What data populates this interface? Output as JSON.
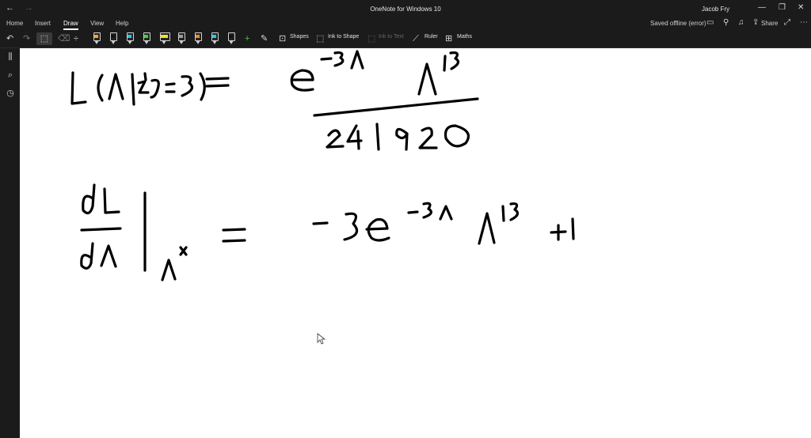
{
  "titlebar": {
    "back_icon": "back-arrow-icon",
    "forward_icon": "forward-arrow-icon",
    "app_title": "OneNote for Windows 10",
    "user_name": "Jacob Fry",
    "minimize_glyph": "—",
    "maximize_glyph": "❐",
    "close_glyph": "✕"
  },
  "ribbon": {
    "tabs": [
      "Home",
      "Insert",
      "Draw",
      "View",
      "Help"
    ],
    "active_tab": "Draw",
    "status_text": "Saved offline (error)",
    "share_label": "Share"
  },
  "toolbar": {
    "shapes_label": "Shapes",
    "ink_to_shape_label": "Ink to Shape",
    "ink_to_text_label": "Ink to Text",
    "ruler_label": "Ruler",
    "maths_label": "Maths",
    "pens": [
      {
        "name": "black-pen-orange-band",
        "band_color": "#f5a623"
      },
      {
        "name": "black-pen",
        "band_color": "#111111"
      },
      {
        "name": "cyan-pen",
        "band_color": "#25c7e8"
      },
      {
        "name": "green-pen",
        "band_color": "#3fcf3a"
      },
      {
        "name": "yellow-highlighter",
        "band_color": "#f6e01b"
      },
      {
        "name": "gray-pen",
        "band_color": "#9a9a9a"
      },
      {
        "name": "orange-pen",
        "band_color": "#f58a1f"
      },
      {
        "name": "cyan-pen-2",
        "band_color": "#25c7e8"
      },
      {
        "name": "black-pen-2",
        "band_color": "#111111"
      }
    ]
  },
  "colors": {
    "chrome_bg": "#1b1b1b",
    "canvas_bg": "#ffffff",
    "ink": "#000000"
  }
}
